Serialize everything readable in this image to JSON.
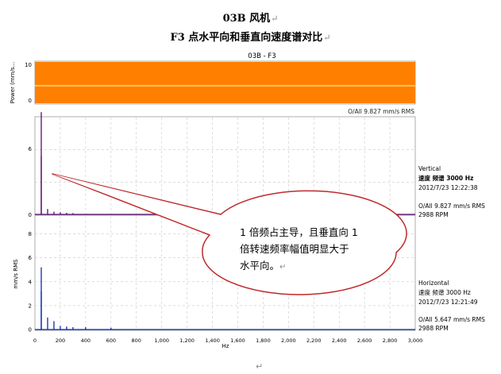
{
  "doc": {
    "title": "03B 风机",
    "subtitle": "F3 点水平向和垂直向速度谱对比",
    "return_mark": "↵"
  },
  "chart_data": [
    {
      "type": "area",
      "title": "03B - F3",
      "ylabel": "Power (mm/s...",
      "ylim": [
        0,
        10
      ],
      "yticks": [
        "0",
        "10"
      ],
      "grid": true,
      "fill_color": "#ff8000",
      "band_line_color": "#ffe0a0"
    },
    {
      "type": "line",
      "name": "Vertical",
      "ylim": [
        0,
        9
      ],
      "yticks": [
        "0",
        "6"
      ],
      "color": "#5a0a6e",
      "overall": "O/All 9.827 mm/s RMS",
      "info": [
        "Vertical",
        "速度 频谱 3000 Hz",
        "2012/7/23 12:22:38"
      ],
      "footer": [
        "O/All 9.827 mm/s RMS",
        "2988 RPM"
      ],
      "spectrum": [
        [
          50,
          9.5
        ],
        [
          50,
          5.4
        ],
        [
          100,
          0.5
        ],
        [
          150,
          0.25
        ],
        [
          200,
          0.2
        ],
        [
          250,
          0.15
        ],
        [
          300,
          0.12
        ]
      ]
    },
    {
      "type": "line",
      "name": "Horizontal",
      "ylabel": "mm/s RMS",
      "xlabel": "Hz",
      "xlim": [
        0,
        3000
      ],
      "xticks": [
        "0",
        "200",
        "400",
        "600",
        "800",
        "1,000",
        "1,200",
        "1,400",
        "1,600",
        "1,800",
        "2,000",
        "2,200",
        "2,400",
        "2,600",
        "2,800",
        "3,000"
      ],
      "ylim": [
        0,
        9.5
      ],
      "yticks": [
        "0",
        "2",
        "4",
        "6",
        "8"
      ],
      "color": "#0a2ab4",
      "info": [
        "Horizontal",
        "速度 频谱 3000 Hz",
        "2012/7/23 12:21:49"
      ],
      "footer": [
        "O/All 5.647 mm/s RMS",
        "2988 RPM"
      ],
      "spectrum": [
        [
          50,
          5.2
        ],
        [
          50,
          3.2
        ],
        [
          100,
          1.0
        ],
        [
          150,
          0.7
        ],
        [
          200,
          0.3
        ],
        [
          250,
          0.25
        ],
        [
          300,
          0.2
        ],
        [
          400,
          0.2
        ],
        [
          600,
          0.15
        ]
      ]
    }
  ],
  "annotation": {
    "text_line1": "1 倍频占主导，且垂直向 1",
    "text_line2": "倍转速频率幅值明显大于",
    "text_line3": "水平向。"
  }
}
